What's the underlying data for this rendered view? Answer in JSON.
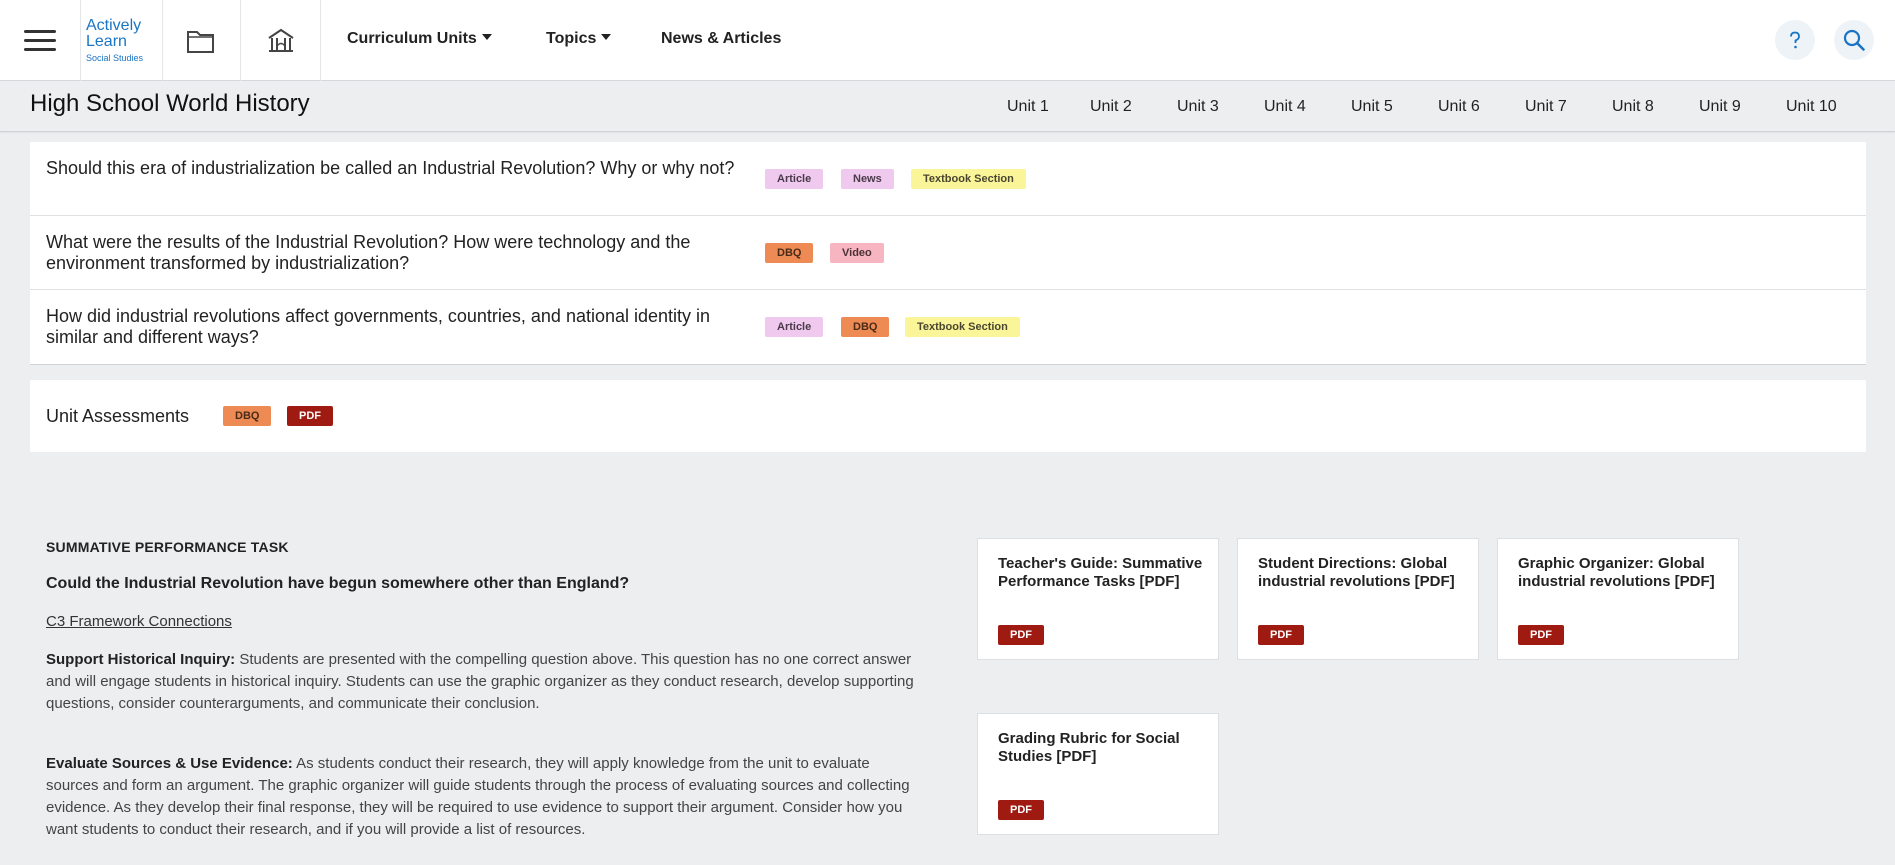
{
  "nav": {
    "logo": {
      "line1": "Actively",
      "line2": "Learn",
      "line3": "Social Studies"
    },
    "menus": [
      {
        "label": "Curriculum Units"
      },
      {
        "label": "Topics"
      },
      {
        "label": "News & Articles"
      }
    ]
  },
  "course": {
    "title": "High School World History",
    "units": [
      "Unit 1",
      "Unit 2",
      "Unit 3",
      "Unit 4",
      "Unit 5",
      "Unit 6",
      "Unit 7",
      "Unit 8",
      "Unit 9",
      "Unit 10"
    ]
  },
  "questions": [
    {
      "text": "Should this era of industrialization be called an Industrial Revolution? Why or why not?",
      "tags": [
        "Article",
        "News",
        "Textbook Section"
      ]
    },
    {
      "text": "What were the results of the Industrial Revolution? How were technology and the environment transformed by industrialization?",
      "tags": [
        "DBQ",
        "Video"
      ]
    },
    {
      "text": "How did industrial revolutions affect governments, countries, and national identity in similar and different ways?",
      "tags": [
        "Article",
        "DBQ",
        "Textbook Section"
      ]
    }
  ],
  "assessments": {
    "title": "Unit Assessments",
    "tags": [
      "DBQ",
      "PDF"
    ],
    "task_label": "SUMMATIVE PERFORMANCE TASK",
    "compelling_question": "Could the Industrial Revolution have begun somewhere other than England?",
    "c3_link": "C3 Framework Connections",
    "support_heading": "Support Historical Inquiry:",
    "support_text": "Students are presented with the compelling question above. This question has no one correct answer and will engage students in historical inquiry. Students can use the graphic organizer as they conduct research, develop supporting questions, consider counterarguments, and communicate their conclusion.",
    "evaluate_heading": "Evaluate Sources & Use Evidence:",
    "evaluate_text": "As students conduct their research, they will apply knowledge from the unit to evaluate sources and form an argument. The graphic organizer will guide students through the process of evaluating sources and collecting evidence. As they develop their final response, they will be required to use evidence to support their argument. Consider how you want students to conduct their research, and if you will provide a list of resources.",
    "resources": [
      {
        "title": "Teacher's Guide: Summative Performance Tasks [PDF]",
        "tag": "PDF"
      },
      {
        "title": "Student Directions: Global industrial revolutions [PDF]",
        "tag": "PDF"
      },
      {
        "title": "Graphic Organizer: Global industrial revolutions [PDF]",
        "tag": "PDF"
      },
      {
        "title": "Grading Rubric for Social Studies [PDF]",
        "tag": "PDF"
      }
    ]
  },
  "colors": {
    "brand": "#1a74c4",
    "tag_article": "#f0c9ef",
    "tag_textbook": "#fbf59a",
    "tag_dbq": "#ee8b55",
    "tag_video": "#f7b5c1",
    "tag_pdf": "#9f1b12"
  },
  "icons": [
    "menu-icon",
    "folder-icon",
    "museum-icon",
    "help-icon",
    "search-icon"
  ]
}
